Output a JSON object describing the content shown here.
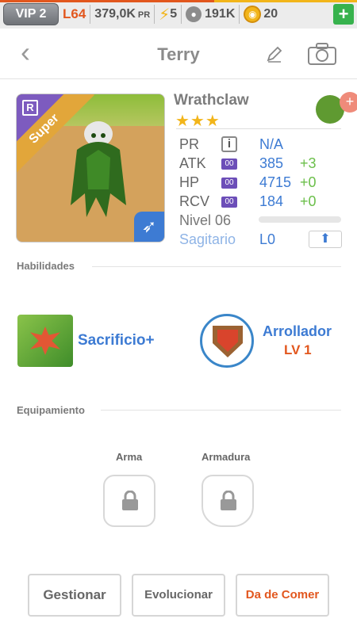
{
  "statusbar": {
    "vip": "VIP 2",
    "level": "L64",
    "pr_value": "379,0K",
    "pr_unit": "PR",
    "energy": "5",
    "paw_count": "191K",
    "coins": "20",
    "add_label": "+"
  },
  "header": {
    "back_icon": "chevron-left-icon",
    "title": "Terry",
    "edit_icon": "pencil-icon",
    "camera_icon": "camera-icon"
  },
  "monster": {
    "card_rarity_letter": "R",
    "card_ribbon": "Super",
    "name": "Wrathclaw",
    "stars": "★★★",
    "element_icon": "leaf-icon",
    "stats": [
      {
        "label": "PR",
        "badge": "i",
        "value": "N/A",
        "bonus": ""
      },
      {
        "label": "ATK",
        "badge": "00",
        "value": "385",
        "bonus": "+3"
      },
      {
        "label": "HP",
        "badge": "00",
        "value": "4715",
        "bonus": "+0"
      },
      {
        "label": "RCV",
        "badge": "00",
        "value": "184",
        "bonus": "+0"
      }
    ],
    "level_label": "Nivel 06",
    "sign_label": "Sagitario",
    "sign_level": "L0"
  },
  "skills": {
    "section_title": "Habilidades",
    "active_skill": "Sacrificio+",
    "passive_skill": "Arrollador",
    "passive_level": "LV 1"
  },
  "equipment": {
    "section_title": "Equipamiento",
    "weapon_label": "Arma",
    "armor_label": "Armadura"
  },
  "actions": {
    "manage": "Gestionar",
    "evolve": "Evolucionar",
    "feed": "Da de Comer"
  },
  "colors": {
    "accent_blue": "#3d7bd3",
    "accent_orange": "#e2571e",
    "bonus_green": "#6bbf4a"
  }
}
